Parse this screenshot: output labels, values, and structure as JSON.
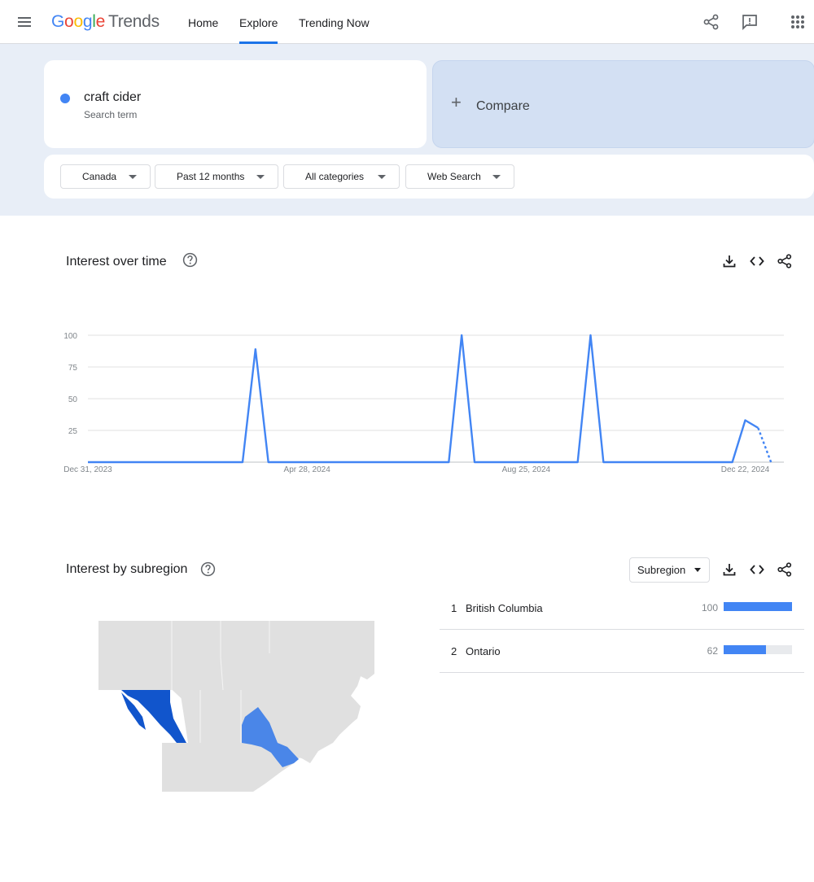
{
  "header": {
    "logo_google": "Google",
    "logo_trends": "Trends",
    "nav": [
      {
        "label": "Home"
      },
      {
        "label": "Explore",
        "active": true
      },
      {
        "label": "Trending Now"
      }
    ],
    "icons": [
      "menu-icon",
      "share-icon",
      "feedback-icon",
      "apps-icon"
    ]
  },
  "search": {
    "term": "craft cider",
    "term_type": "Search term",
    "term_color": "#4285f4",
    "compare_label": "Compare"
  },
  "filters": [
    {
      "label": "Canada"
    },
    {
      "label": "Past 12 months"
    },
    {
      "label": "All categories"
    },
    {
      "label": "Web Search"
    }
  ],
  "interest_over_time": {
    "title": "Interest over time",
    "icons": [
      "help-icon",
      "download-icon",
      "embed-icon",
      "share-icon"
    ]
  },
  "chart_data": {
    "type": "line",
    "title": "",
    "xlabel": "",
    "ylabel": "",
    "ylim": [
      0,
      100
    ],
    "yticks": [
      "25",
      "50",
      "75",
      "100"
    ],
    "xticks": [
      "Dec 31, 2023",
      "Apr 28, 2024",
      "Aug 25, 2024",
      "Dec 22, 2024"
    ],
    "x": [
      "2023-12-31",
      "2024-01-07",
      "2024-01-14",
      "2024-01-21",
      "2024-01-28",
      "2024-02-04",
      "2024-02-11",
      "2024-02-18",
      "2024-02-25",
      "2024-03-03",
      "2024-03-10",
      "2024-03-17",
      "2024-03-24",
      "2024-03-31",
      "2024-04-07",
      "2024-04-14",
      "2024-04-21",
      "2024-04-28",
      "2024-05-05",
      "2024-05-12",
      "2024-05-19",
      "2024-05-26",
      "2024-06-02",
      "2024-06-09",
      "2024-06-16",
      "2024-06-23",
      "2024-06-30",
      "2024-07-07",
      "2024-07-14",
      "2024-07-21",
      "2024-07-28",
      "2024-08-04",
      "2024-08-11",
      "2024-08-18",
      "2024-08-25",
      "2024-09-01",
      "2024-09-08",
      "2024-09-15",
      "2024-09-22",
      "2024-09-29",
      "2024-10-06",
      "2024-10-13",
      "2024-10-20",
      "2024-10-27",
      "2024-11-03",
      "2024-11-10",
      "2024-11-17",
      "2024-11-24",
      "2024-12-01",
      "2024-12-08",
      "2024-12-15",
      "2024-12-22",
      "2024-12-29",
      "2025-01-05",
      "2025-01-12"
    ],
    "series": [
      {
        "color": "#4285f4",
        "values": [
          0,
          0,
          0,
          0,
          0,
          0,
          0,
          0,
          0,
          0,
          0,
          0,
          0,
          89,
          0,
          0,
          0,
          0,
          0,
          0,
          0,
          0,
          0,
          0,
          0,
          0,
          0,
          0,
          0,
          100,
          0,
          0,
          0,
          0,
          0,
          0,
          0,
          0,
          0,
          100,
          0,
          0,
          0,
          0,
          0,
          0,
          0,
          0,
          0,
          0,
          0,
          33,
          27,
          0
        ],
        "partial_from_index": 52
      }
    ],
    "grid": true
  },
  "interest_by_subregion": {
    "title": "Interest by subregion",
    "select_label": "Subregion",
    "regions": [
      {
        "rank": "1",
        "name": "British Columbia",
        "value": "100",
        "fraction": 1.0
      },
      {
        "rank": "2",
        "name": "Ontario",
        "value": "62",
        "fraction": 0.62
      }
    ],
    "map_colors": {
      "high": "#1155cc",
      "mid": "#4a86e8",
      "none": "#e0e0e0"
    }
  }
}
